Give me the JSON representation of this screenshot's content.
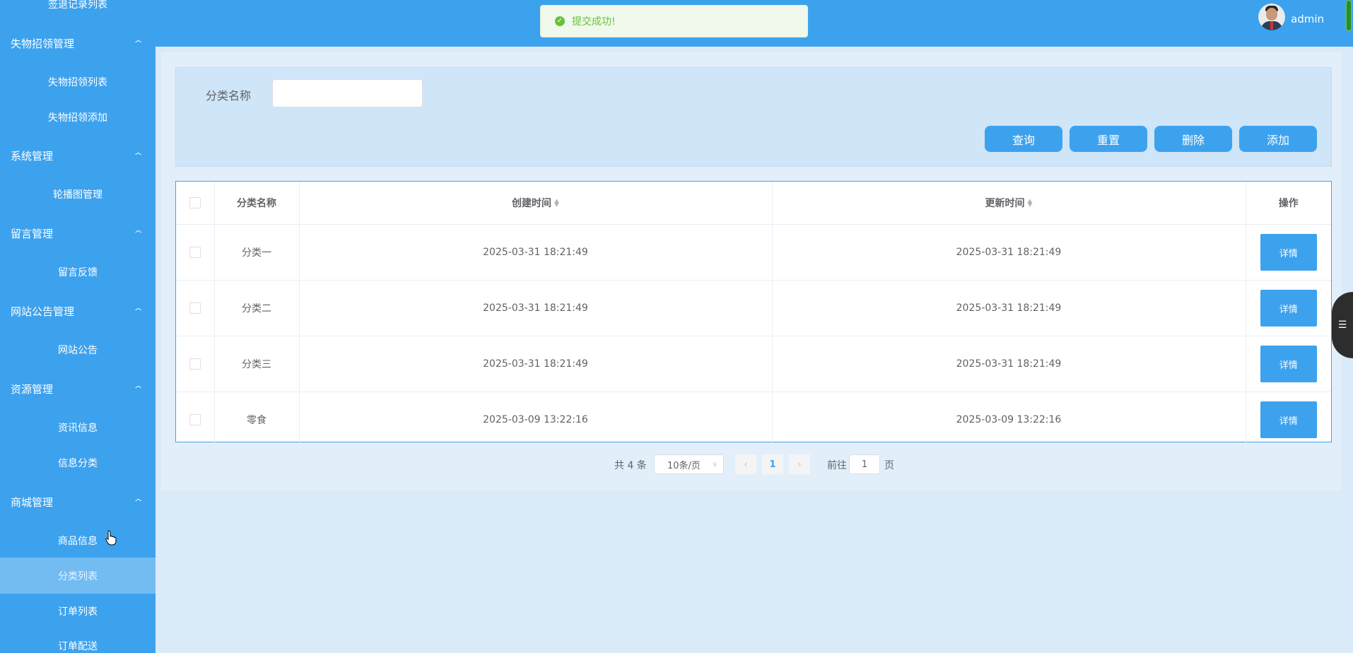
{
  "sidebar": {
    "items": [
      {
        "type": "item",
        "label": "签退记录列表"
      },
      {
        "type": "group",
        "label": "失物招领管理"
      },
      {
        "type": "item",
        "label": "失物招领列表"
      },
      {
        "type": "item",
        "label": "失物招领添加"
      },
      {
        "type": "group",
        "label": "系统管理"
      },
      {
        "type": "item",
        "label": "轮播图管理"
      },
      {
        "type": "group",
        "label": "留言管理"
      },
      {
        "type": "item",
        "label": "留言反馈"
      },
      {
        "type": "group",
        "label": "网站公告管理"
      },
      {
        "type": "item",
        "label": "网站公告"
      },
      {
        "type": "group",
        "label": "资源管理"
      },
      {
        "type": "item",
        "label": "资讯信息"
      },
      {
        "type": "item",
        "label": "信息分类"
      },
      {
        "type": "group",
        "label": "商城管理"
      },
      {
        "type": "item",
        "label": "商品信息"
      },
      {
        "type": "item",
        "label": "分类列表",
        "active": true
      },
      {
        "type": "item",
        "label": "订单列表"
      },
      {
        "type": "item",
        "label": "订单配送"
      }
    ],
    "chevron": "^"
  },
  "header": {
    "username": "admin"
  },
  "toast": {
    "text": "提交成功!"
  },
  "search": {
    "label": "分类名称",
    "value": "",
    "buttons": {
      "query": "查询",
      "reset": "重置",
      "delete": "删除",
      "add": "添加"
    }
  },
  "table": {
    "headers": {
      "name": "分类名称",
      "created": "创建时间",
      "updated": "更新时间",
      "action": "操作"
    },
    "detail_label": "详情",
    "rows": [
      {
        "name": "分类一",
        "created": "2025-03-31 18:21:49",
        "updated": "2025-03-31 18:21:49"
      },
      {
        "name": "分类二",
        "created": "2025-03-31 18:21:49",
        "updated": "2025-03-31 18:21:49"
      },
      {
        "name": "分类三",
        "created": "2025-03-31 18:21:49",
        "updated": "2025-03-31 18:21:49"
      },
      {
        "name": "零食",
        "created": "2025-03-09 13:22:16",
        "updated": "2025-03-09 13:22:16"
      }
    ]
  },
  "pagination": {
    "total_text": "共 4 条",
    "page_size": "10条/页",
    "current_page": "1",
    "goto_label": "前往",
    "goto_value": "1",
    "goto_unit": "页"
  },
  "colors": {
    "primary": "#3da2ee",
    "success": "#67c23a",
    "background": "#dbeaf8"
  }
}
